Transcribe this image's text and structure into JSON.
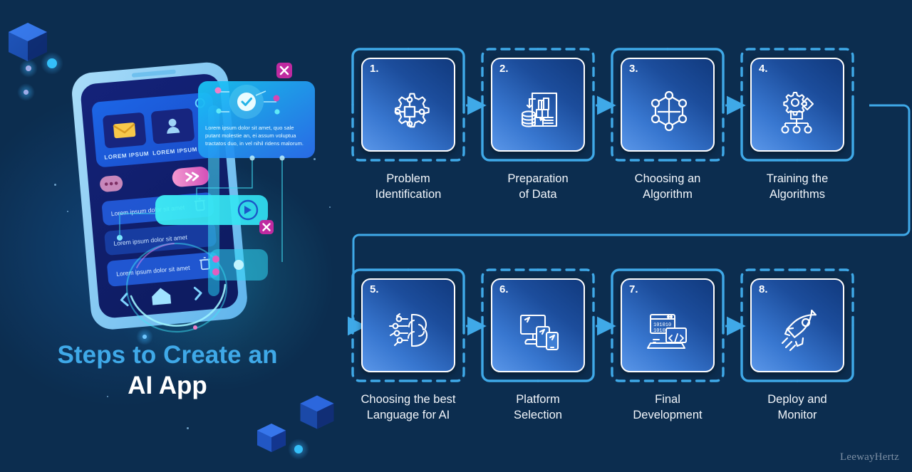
{
  "title": {
    "line1": "Steps to Create an",
    "line2": "AI App"
  },
  "watermark": "LeewayHertz",
  "colors": {
    "background": "#0c2d4f",
    "accent_blue": "#3fa9e8",
    "title_blue": "#3fa9e8",
    "title_white": "#ffffff",
    "card_gradient_from": "#113a7e",
    "card_gradient_to": "#5a96e8",
    "card_border": "#ffffff",
    "connector": "#3fa9e8",
    "caption_text": "#f2f6fb",
    "watermark_text": "#7c8fa4",
    "magenta": "#c0289f",
    "cyan": "#2fe6f2"
  },
  "steps": [
    {
      "number": "1.",
      "label_line1": "Problem",
      "label_line2": "Identification",
      "icon": "gear-network-icon",
      "frame_style": "solid-top-dashed-bottom"
    },
    {
      "number": "2.",
      "label_line1": "Preparation",
      "label_line2": "of Data",
      "icon": "database-document-icon",
      "frame_style": "dashed-top-solid-bottom"
    },
    {
      "number": "3.",
      "label_line1": "Choosing an",
      "label_line2": "Algorithm",
      "icon": "hexagon-nodes-icon",
      "frame_style": "solid-top-dashed-bottom"
    },
    {
      "number": "4.",
      "label_line1": "Training the",
      "label_line2": "Algorithms",
      "icon": "gear-hierarchy-icon",
      "frame_style": "dashed-top-solid-bottom"
    },
    {
      "number": "5.",
      "label_line1": "Choosing the best",
      "label_line2": "Language for AI",
      "icon": "ai-brain-icon",
      "frame_style": "solid-top-dashed-bottom"
    },
    {
      "number": "6.",
      "label_line1": "Platform",
      "label_line2": "Selection",
      "icon": "multi-device-icon",
      "frame_style": "dashed-top-solid-bottom"
    },
    {
      "number": "7.",
      "label_line1": "Final",
      "label_line2": "Development",
      "icon": "code-laptop-icon",
      "frame_style": "solid-top-dashed-bottom"
    },
    {
      "number": "8.",
      "label_line1": "Deploy and",
      "label_line2": "Monitor",
      "icon": "rocket-icon",
      "frame_style": "dashed-top-solid-bottom"
    }
  ],
  "illustration": {
    "name": "ai-mobile-app-illustration",
    "tile_label_1": "LOREM IPSUM",
    "tile_label_2": "LOREM IPSUM",
    "popup_text": "Lorem ipsum dolor sit amet, quo sale putant molestie an, ei assum voluptua tractatos duo, in vel nihil ridens malorum.",
    "list_item_1": "Lorem ipsum dolor sit amet",
    "list_item_2": "Lorem ipsum dolor sit amet",
    "list_item_3": "Lorem ipsum dolor sit amet"
  }
}
